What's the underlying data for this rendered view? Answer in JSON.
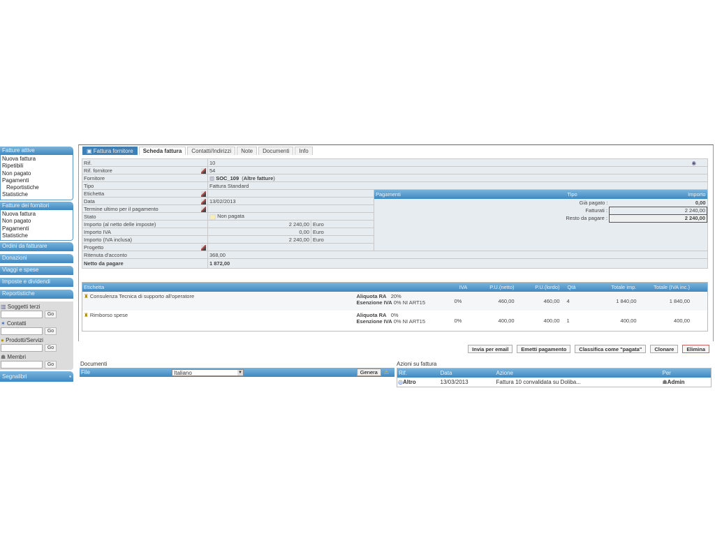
{
  "sidebar": {
    "active": {
      "title": "Fatture attive",
      "items": [
        "Nuova fattura",
        "Ripetibili",
        "Non pagato",
        "Pagamenti",
        "Reportistiche",
        "Statistiche"
      ]
    },
    "suppliers": {
      "title": "Fatture dei fornitori",
      "items": [
        "Nuova fattura",
        "Non pagato",
        "Pagamenti",
        "Statistiche"
      ]
    },
    "menus": [
      "Ordini da fatturare",
      "Donazioni",
      "Viaggi e spese",
      "Imposte e dividendi",
      "Reportistiche"
    ],
    "search": [
      {
        "label": "Soggetti terzi",
        "icon": "company-icon"
      },
      {
        "label": "Contatti",
        "icon": "contact-icon"
      },
      {
        "label": "Prodotti/Servizi",
        "icon": "product-icon"
      },
      {
        "label": "Membri",
        "icon": "member-icon"
      }
    ],
    "go": "Go",
    "bookmarks": "Segnalibri"
  },
  "tabs": [
    "Fattura fornitore",
    "Scheda fattura",
    "Contatti/Indirizzi",
    "Note",
    "Documenti",
    "Info"
  ],
  "card": {
    "rif_label": "Rif.",
    "rif": "10",
    "rif_forn_label": "Rif. fornitore",
    "rif_forn": "54",
    "fornitore_label": "Fornitore",
    "fornitore": "SOC_109",
    "fornitore_link": "Altre fatture",
    "tipo_label": "Tipo",
    "tipo": "Fattura Standard",
    "etichetta_label": "Etichetta",
    "data_label": "Data",
    "data": "13/02/2013",
    "termine_label": "Termine ultimo per il pagamento",
    "stato_label": "Stato",
    "stato": "Non pagata",
    "imp_netto_label": "Importo (al netto delle imposte)",
    "imp_netto": "2 240,00",
    "imp_iva_label": "Importo IVA",
    "imp_iva": "0,00",
    "imp_tot_label": "Importo (IVA inclusa)",
    "imp_tot": "2 240,00",
    "currency": "Euro",
    "progetto_label": "Progetto",
    "ritenuta_label": "Ritenuta d'acconto",
    "ritenuta": "368,00",
    "netto_label": "Netto da pagare",
    "netto": "1 872,00"
  },
  "payments": {
    "headers": [
      "Pagamenti",
      "Tipo",
      "Importo"
    ],
    "gia_label": "Già pagato :",
    "gia": "0,00",
    "fatt_label": "Fatturati :",
    "fatt": "2 240,00",
    "resto_label": "Resto da pagare :",
    "resto": "2 240,00"
  },
  "lines": {
    "headers": [
      "Etichetta",
      "",
      "IVA",
      "P.U.(netto)",
      "P.U.(lordo)",
      "Qtà",
      "Totale imp.",
      "Totale (IVA inc.)"
    ],
    "ra_label": "Aliquota RA",
    "es_label": "Esenzione IVA",
    "rows": [
      {
        "desc": "Consulenza Tecnica di supporto all'operatore",
        "ra": "20%",
        "es": "0% NI ART15",
        "iva": "0%",
        "pun": "460,00",
        "pul": "460,00",
        "qty": "4",
        "tot": "1 840,00",
        "totiva": "1 840,00"
      },
      {
        "desc": "Rimborso spese",
        "ra": "0%",
        "es": "0% NI ART15",
        "iva": "0%",
        "pun": "400,00",
        "pul": "400,00",
        "qty": "1",
        "tot": "400,00",
        "totiva": "400,00"
      }
    ]
  },
  "actions": {
    "email": "Invia per email",
    "pay": "Emetti pagamento",
    "classify": "Classifica come \"pagata\"",
    "clone": "Clonare",
    "delete": "Elimina"
  },
  "documents": {
    "title": "Documenti",
    "file": "File",
    "lang": "Italiano",
    "generate": "Genera"
  },
  "events": {
    "title": "Azioni su fattura",
    "headers": [
      "Rif.",
      "Data",
      "Azione",
      "Per"
    ],
    "row": {
      "ref": "Altro",
      "date": "13/03/2013",
      "action": "Fattura 10 convalidata su Doliba...",
      "by": "Admin"
    }
  }
}
